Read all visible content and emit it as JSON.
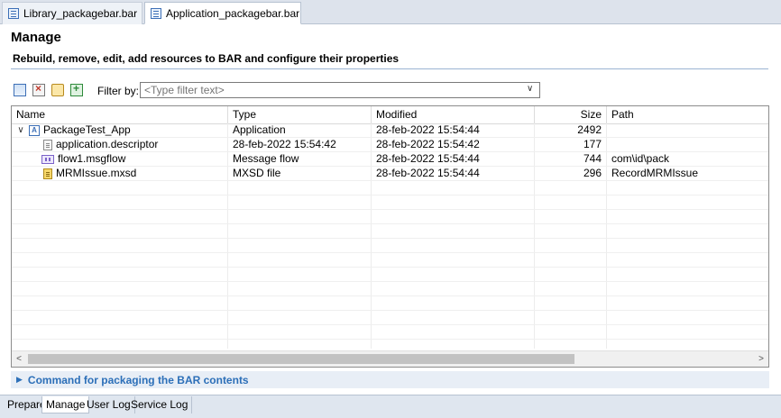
{
  "editor_tabs": [
    {
      "label": "Library_packagebar.bar",
      "active": false
    },
    {
      "label": "Application_packagebar.bar",
      "active": true,
      "closable": true
    }
  ],
  "header": {
    "title": "Manage",
    "subtitle": "Rebuild, remove, edit, add resources to BAR and configure their properties"
  },
  "toolbar": {
    "icons": [
      "rebuild-icon",
      "remove-icon",
      "edit-icon",
      "add-icon"
    ],
    "filter_label": "Filter by:",
    "filter_placeholder": "<Type filter text>"
  },
  "table": {
    "columns": [
      "Name",
      "Type",
      "Modified",
      "Size",
      "Path"
    ],
    "rows": [
      {
        "name": "PackageTest_App",
        "icon": "application-icon",
        "expanded": true,
        "indent": 0,
        "type": "Application",
        "modified": "28-feb-2022  15:54:44",
        "size": "2492",
        "path": ""
      },
      {
        "name": "application.descriptor",
        "icon": "descriptor-icon",
        "indent": 1,
        "type": "28-feb-2022  15:54:42",
        "modified": "28-feb-2022  15:54:42",
        "size": "177",
        "path": ""
      },
      {
        "name": "flow1.msgflow",
        "icon": "msgflow-icon",
        "indent": 1,
        "type": "Message flow",
        "modified": "28-feb-2022  15:54:44",
        "size": "744",
        "path": "com\\id\\pack"
      },
      {
        "name": "MRMIssue.mxsd",
        "icon": "mxsd-icon",
        "indent": 1,
        "type": "MXSD file",
        "modified": "28-feb-2022  15:54:44",
        "size": "296",
        "path": "RecordMRMIssue"
      }
    ]
  },
  "command_section": {
    "label": "Command for packaging the BAR contents"
  },
  "page_tabs": [
    {
      "label": "Prepare",
      "active": false
    },
    {
      "label": "Manage",
      "active": true
    },
    {
      "label": "User Log",
      "active": false
    },
    {
      "label": "Service Log",
      "active": false
    }
  ],
  "colors": {
    "accent": "#2c6fb8",
    "tab_bg": "#dde3ec"
  }
}
